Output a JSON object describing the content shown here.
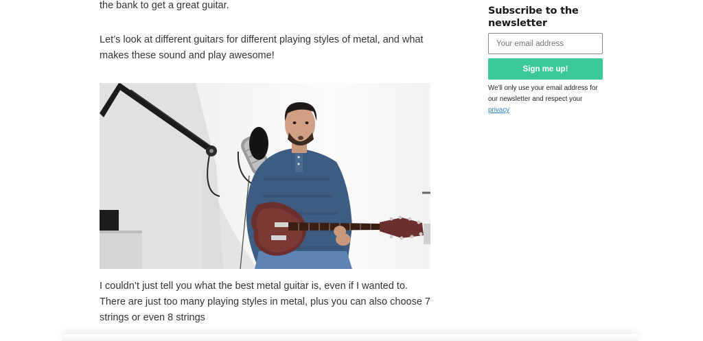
{
  "article": {
    "paragraph_1": "the bank to get a great guitar.",
    "paragraph_2": "Let’s look at different guitars for different playing styles of metal, and what makes these sound and play awesome!",
    "paragraph_3": "I couldn’t just tell you what the best metal guitar is, even if I wanted to. There are just too many playing styles in metal, plus you can also choose 7 strings or even 8 strings"
  },
  "sidebar": {
    "title": "Subscribe to the newsletter",
    "email_placeholder": "Your email address",
    "signup_label": "Sign me up!",
    "privacy_text": "We'll only use your email address for our newsletter and respect your",
    "privacy_link": "privacy"
  },
  "colors": {
    "accent": "#3cc99a",
    "link": "#2b7bb9"
  }
}
